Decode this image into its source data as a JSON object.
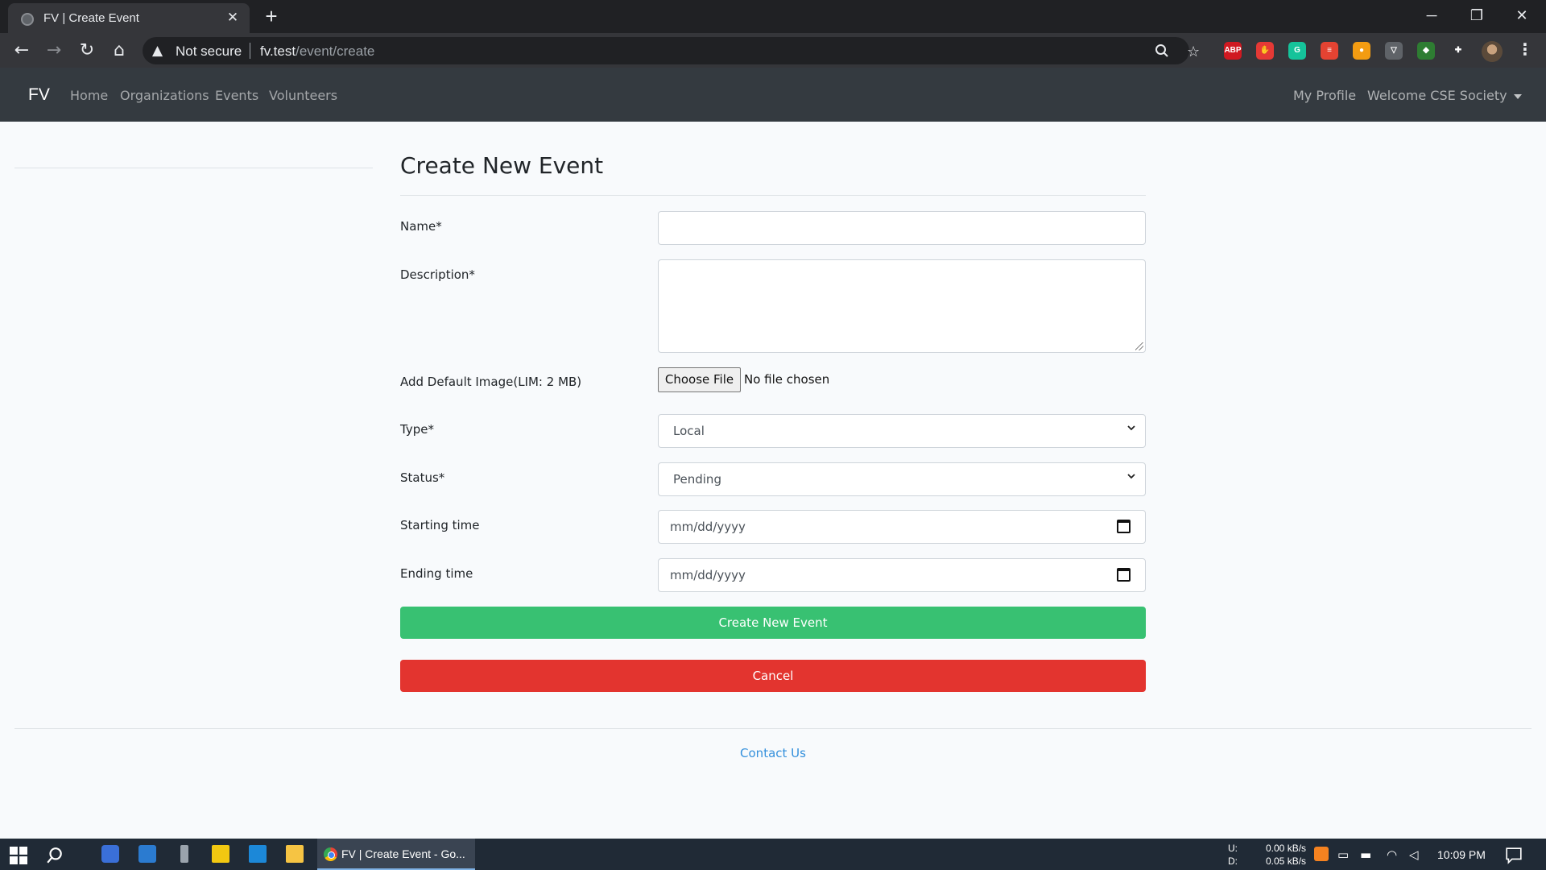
{
  "browser": {
    "tab_title": "FV | Create Event",
    "close_glyph": "✕",
    "new_tab_glyph": "+",
    "window_controls": {
      "minimize": "─",
      "restore": "❐",
      "close": "✕"
    },
    "nav": {
      "back": "←",
      "forward": "→",
      "reload": "↻",
      "home": "⌂"
    },
    "security_label": "Not secure",
    "url_host": "fv.test",
    "url_path": "/event/create",
    "zoom_icon": "search-icon",
    "bookmark_icon": "star-icon",
    "extensions": [
      {
        "name": "abp-icon",
        "label": "ABP",
        "color": "#d01921"
      },
      {
        "name": "stop-icon",
        "label": "✋",
        "color": "#e53935"
      },
      {
        "name": "grammarly-icon",
        "label": "G",
        "color": "#15c39a"
      },
      {
        "name": "todoist-icon",
        "label": "≡",
        "color": "#e44332"
      },
      {
        "name": "bulb-icon",
        "label": "●",
        "color": "#f39c12"
      },
      {
        "name": "shield-icon",
        "label": "▽",
        "color": "#5f6368"
      },
      {
        "name": "colorful-icon",
        "label": "◆",
        "color": "#2e7d32"
      },
      {
        "name": "puzzle-icon",
        "label": "✚",
        "color": "#35363a"
      }
    ],
    "menu_glyph": "⋮"
  },
  "navbar": {
    "brand": "FV",
    "links": [
      "Home",
      "Organizations",
      "Events",
      "Volunteers"
    ],
    "my_profile": "My Profile",
    "welcome": "Welcome CSE Society"
  },
  "form": {
    "title": "Create New Event",
    "name_label": "Name*",
    "name_value": "",
    "description_label": "Description*",
    "description_value": "",
    "image_label": "Add Default Image(LIM: 2 MB)",
    "choose_file_label": "Choose File",
    "no_file_text": "No file chosen",
    "type_label": "Type*",
    "type_value": "Local",
    "status_label": "Status*",
    "status_value": "Pending",
    "start_label": "Starting time",
    "start_placeholder": "mm/dd/yyyy",
    "end_label": "Ending time",
    "end_placeholder": "mm/dd/yyyy",
    "submit_label": "Create New Event",
    "cancel_label": "Cancel"
  },
  "footer": {
    "contact_label": "Contact Us"
  },
  "taskbar": {
    "active_app_label": "FV | Create Event - Go...",
    "net_up_label": "U:",
    "net_down_label": "D:",
    "net_up": "0.00 kB/s",
    "net_down": "0.05 kB/s",
    "clock": "10:09 PM"
  }
}
